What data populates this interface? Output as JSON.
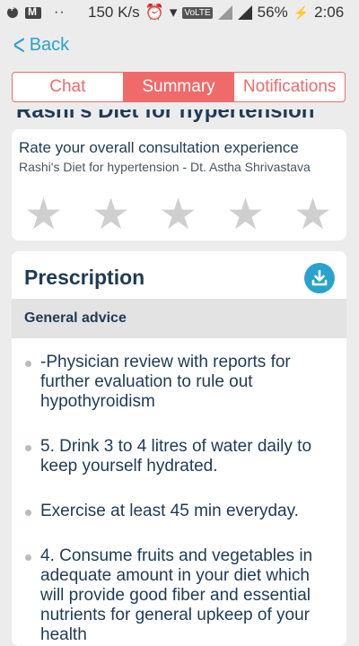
{
  "status_bar": {
    "speed": "150 K/s",
    "network_badge": "VoLTE",
    "battery": "56%",
    "time": "2:06"
  },
  "header": {
    "back_label": "Back"
  },
  "tabs": [
    {
      "label": "Chat",
      "active": false
    },
    {
      "label": "Summary",
      "active": true
    },
    {
      "label": "Notifications",
      "active": false
    }
  ],
  "cutoff_title": "Rashi's Diet for hypertension",
  "rating": {
    "title": "Rate your overall consultation experience",
    "subtitle": "Rashi's Diet for hypertension - Dt. Astha Shrivastava",
    "stars_filled": 0,
    "stars_total": 5
  },
  "prescription": {
    "title": "Prescription",
    "section_title": "General advice",
    "items": [
      "-Physician review with reports for further evaluation to rule out hypothyroidism",
      "5. Drink 3 to 4 litres of water daily to keep yourself hydrated.",
      "Exercise at least 45 min everyday.",
      "4. Consume fruits and vegetables in adequate amount in your diet which will provide good fiber and essential nutrients for general upkeep of your health"
    ]
  },
  "colors": {
    "accent": "#f06a6a",
    "link": "#2aa3cc",
    "text": "#1f3b54"
  }
}
